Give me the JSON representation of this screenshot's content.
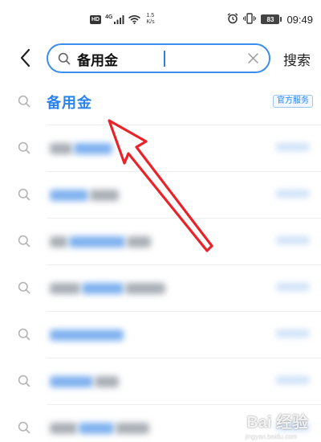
{
  "status_bar": {
    "network_hd": "HD",
    "network_4g": "4G",
    "speed_value": "1.5",
    "speed_unit": "K/s",
    "battery": "83",
    "time": "09:49",
    "icons": [
      "signal-icon",
      "wifi-icon",
      "alarm-icon",
      "vibrate-icon",
      "battery-icon"
    ]
  },
  "header": {
    "back_icon": "chevron-left-icon",
    "search_value": "备用金",
    "search_submit_label": "搜索"
  },
  "suggestions": [
    {
      "text": "备用金",
      "badge": "官方服务",
      "icon": "search-icon"
    }
  ],
  "watermark": {
    "logo": "Bai 经验",
    "url": "jingyan.baidu.com"
  },
  "colors": {
    "accent": "#2b83ee",
    "annotation": "#e8242a"
  }
}
